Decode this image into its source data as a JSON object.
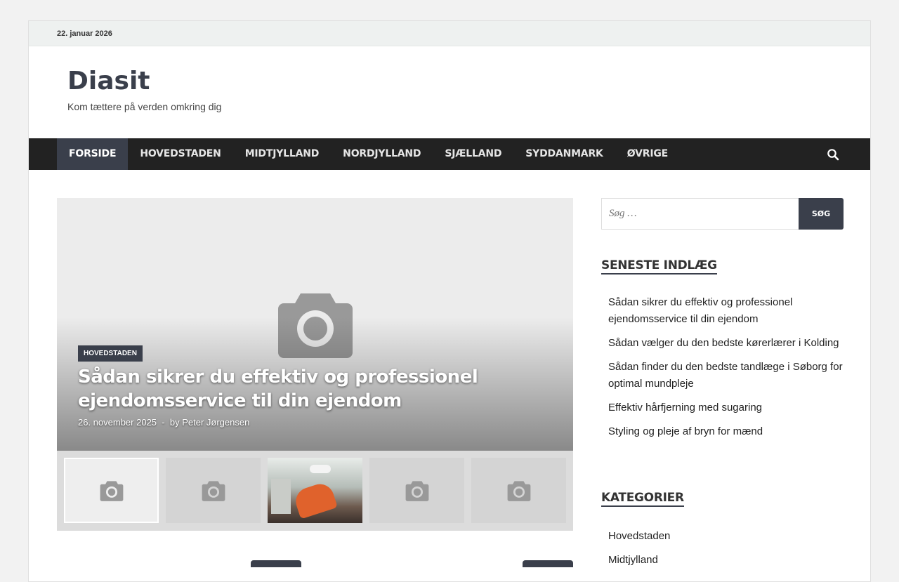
{
  "topbar": {
    "date": "22. januar 2026"
  },
  "site": {
    "title": "Diasit",
    "tagline": "Kom tættere på verden omkring dig"
  },
  "nav": {
    "items": [
      {
        "label": "FORSIDE",
        "active": true
      },
      {
        "label": "HOVEDSTADEN"
      },
      {
        "label": "MIDTJYLLAND"
      },
      {
        "label": "NORDJYLLAND"
      },
      {
        "label": "SJÆLLAND"
      },
      {
        "label": "SYDDANMARK"
      },
      {
        "label": "ØVRIGE"
      }
    ],
    "search_icon": "search-icon"
  },
  "slider": {
    "category": "HOVEDSTADEN",
    "title": "Sådan sikrer du effektiv og professionel ejendomsservice til din ejendom",
    "date": "26. november 2025",
    "by": "by",
    "author": "Peter Jørgensen",
    "thumbnails": [
      "camera-icon",
      "camera-icon",
      "photo",
      "camera-icon",
      "camera-icon"
    ]
  },
  "sidebar": {
    "search": {
      "placeholder": "Søg …",
      "button": "SØG"
    },
    "recent": {
      "title": "SENESTE INDLÆG",
      "items": [
        "Sådan sikrer du effektiv og professionel ejendomsservice til din ejendom",
        "Sådan vælger du den bedste kørerlærer i Kolding",
        "Sådan finder du den bedste tandlæge i Søborg for optimal mundpleje",
        "Effektiv hårfjerning med sugaring",
        "Styling og pleje af bryn for mænd"
      ]
    },
    "categories": {
      "title": "KATEGORIER",
      "items": [
        "Hovedstaden",
        "Midtjylland"
      ]
    }
  },
  "colors": {
    "accent": "#3a3f4b",
    "nav_bg": "#222222",
    "page_bg": "#f2f2f2"
  }
}
